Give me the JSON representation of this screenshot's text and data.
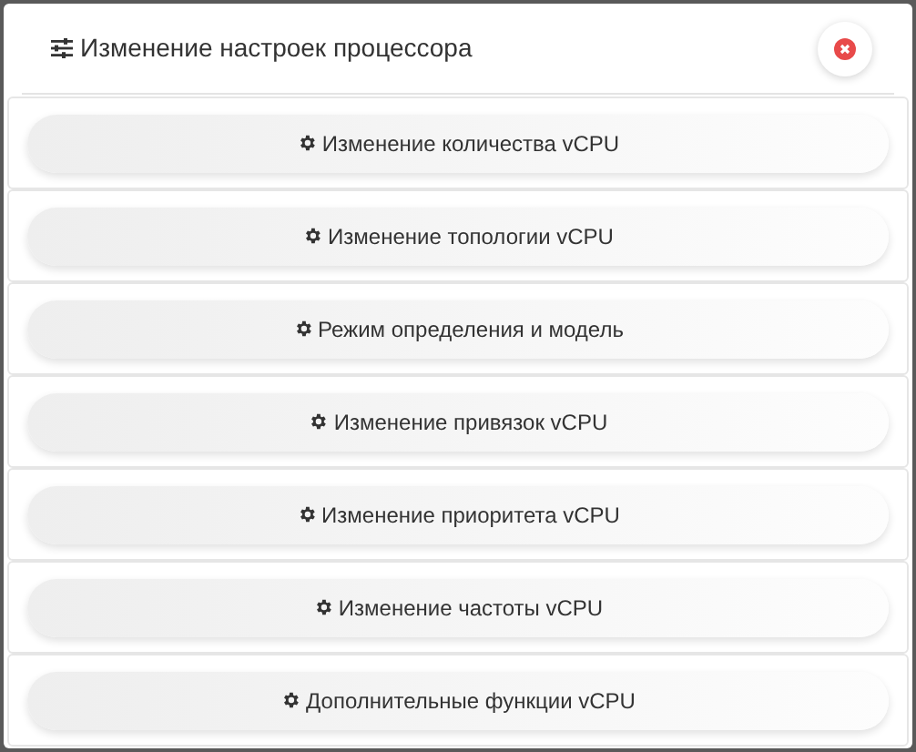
{
  "dialog": {
    "title": "Изменение настроек процессора"
  },
  "actions": [
    {
      "label": "Изменение количества vCPU"
    },
    {
      "label": "Изменение топологии vCPU"
    },
    {
      "label": "Режим определения и модель"
    },
    {
      "label": "Изменение привязок vCPU"
    },
    {
      "label": "Изменение приоритета vCPU"
    },
    {
      "label": "Изменение частоты vCPU"
    },
    {
      "label": "Дополнительные функции vCPU"
    }
  ]
}
